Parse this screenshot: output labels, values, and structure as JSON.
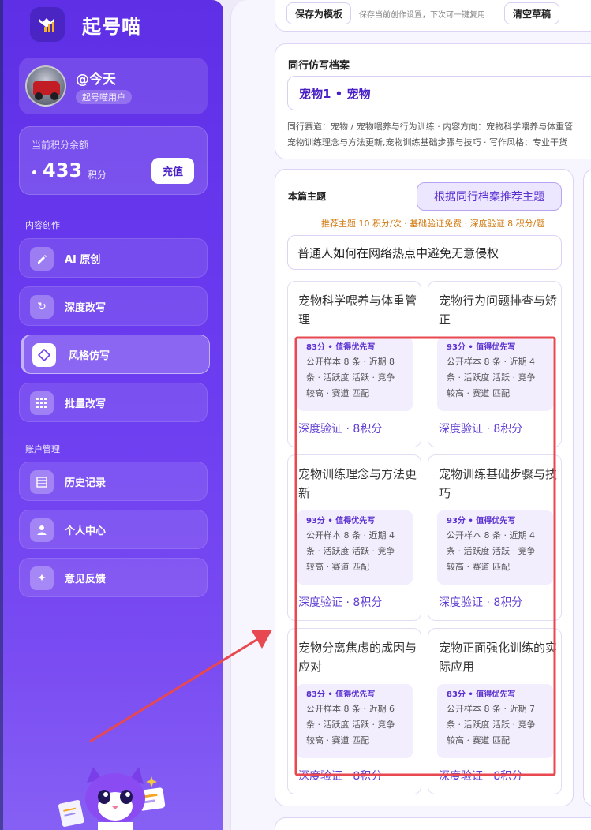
{
  "app": {
    "title": "起号喵"
  },
  "profile": {
    "username": "@今天",
    "badge": "起号喵用户"
  },
  "points": {
    "label": "当前积分余额",
    "value": "433",
    "unit": "积分",
    "recharge": "充值"
  },
  "nav": {
    "section_content": "内容创作",
    "section_account": "账户管理",
    "items": [
      {
        "label": "AI 原创",
        "icon": "pencil-icon"
      },
      {
        "label": "深度改写",
        "icon": "refresh-icon"
      },
      {
        "label": "风格仿写",
        "icon": "diamond-icon",
        "active": true
      },
      {
        "label": "批量改写",
        "icon": "grid-icon"
      },
      {
        "label": "历史记录",
        "icon": "list-icon"
      },
      {
        "label": "个人中心",
        "icon": "user-icon"
      },
      {
        "label": "意见反馈",
        "icon": "sparkle-icon"
      }
    ]
  },
  "template": {
    "save_label": "保存为模板",
    "hint": "保存当前创作设置，下次可一键复用",
    "clear_label": "清空草稿"
  },
  "peer": {
    "title": "同行仿写档案",
    "value": "宠物1 • 宠物",
    "desc_line1": "同行赛道：宠物 / 宠物喂养与行为训练 · 内容方向：宠物科学喂养与体重管",
    "desc_line2": "宠物训练理念与方法更新,宠物训练基础步骤与技巧 · 写作风格：专业干货"
  },
  "topic": {
    "title": "本篇主题",
    "recommend_btn": "根据同行档案推荐主题",
    "cost_note": "推荐主题 10 积分/次 · 基础验证免费 · 深度验证 8 积分/题",
    "current": "普通人如何在网络热点中避免无意侵权",
    "cards": [
      {
        "title": "宠物科学喂养与体重管理",
        "score": "83分 • 值得优先写",
        "desc": "公开样本 8 条 · 近期 8 条 · 活跃度 活跃 · 竞争 较高 · 赛道 匹配",
        "verify": "深度验证 · 8积分"
      },
      {
        "title": "宠物行为问题排查与矫正",
        "score": "93分 • 值得优先写",
        "desc": "公开样本 8 条 · 近期 4 条 · 活跃度 活跃 · 竞争 较高 · 赛道 匹配",
        "verify": "深度验证 · 8积分"
      },
      {
        "title": "宠物训练理念与方法更新",
        "score": "93分 • 值得优先写",
        "desc": "公开样本 8 条 · 近期 4 条 · 活跃度 活跃 · 竞争 较高 · 赛道 匹配",
        "verify": "深度验证 · 8积分"
      },
      {
        "title": "宠物训练基础步骤与技巧",
        "score": "93分 • 值得优先写",
        "desc": "公开样本 8 条 · 近期 4 条 · 活跃度 活跃 · 竞争 较高 · 赛道 匹配",
        "verify": "深度验证 · 8积分"
      },
      {
        "title": "宠物分离焦虑的成因与应对",
        "score": "83分 • 值得优先写",
        "desc": "公开样本 8 条 · 近期 6 条 · 活跃度 活跃 · 竞争 较高 · 赛道 匹配",
        "verify": "深度验证 · 8积分"
      },
      {
        "title": "宠物正面强化训练的实际应用",
        "score": "83分 • 值得优先写",
        "desc": "公开样本 8 条 · 近期 7 条 · 活跃度 活跃 · 竞争 较高 · 赛道 匹配",
        "verify": "深度验证 · 8积分"
      }
    ]
  },
  "colors": {
    "accent": "#6b3cf0",
    "annotation": "#e8484f",
    "warning": "#d0780f"
  }
}
